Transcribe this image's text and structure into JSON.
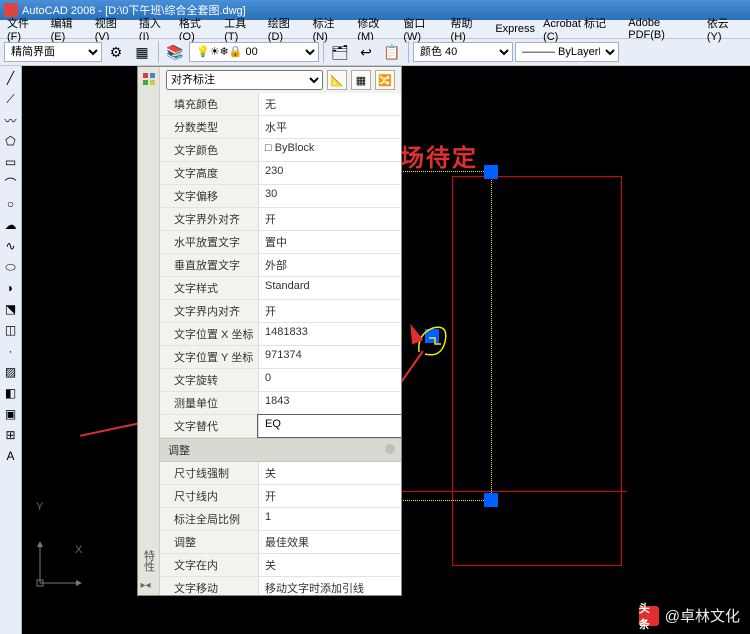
{
  "title": "AutoCAD 2008 - [D:\\0下午班\\综合全套图.dwg]",
  "menus": [
    "文件(F)",
    "编辑(E)",
    "视图(V)",
    "插入(I)",
    "格式(O)",
    "工具(T)",
    "绘图(D)",
    "标注(N)",
    "修改(M)",
    "窗口(W)",
    "帮助(H)",
    "Express",
    "Acrobat 标记(C)",
    "Adobe PDF(B)",
    "依云(Y)"
  ],
  "toolbar": {
    "workspace": "精简界面",
    "layer": "0",
    "color_label": "颜色",
    "color_value": "40",
    "linetype": "ByLayer"
  },
  "annotation": "尺寸现场待定",
  "palette": {
    "title": "特性",
    "selector": "对齐标注",
    "sections": [
      {
        "name": null,
        "rows": [
          {
            "label": "填充颜色",
            "value": "无"
          },
          {
            "label": "分数类型",
            "value": "水平"
          },
          {
            "label": "文字颜色",
            "value": "□ ByBlock"
          },
          {
            "label": "文字高度",
            "value": "230"
          },
          {
            "label": "文字偏移",
            "value": "30"
          },
          {
            "label": "文字界外对齐",
            "value": "开"
          },
          {
            "label": "水平放置文字",
            "value": "置中"
          },
          {
            "label": "垂直放置文字",
            "value": "外部"
          },
          {
            "label": "文字样式",
            "value": "Standard"
          },
          {
            "label": "文字界内对齐",
            "value": "开"
          },
          {
            "label": "文字位置 X 坐标",
            "value": "1481833"
          },
          {
            "label": "文字位置 Y 坐标",
            "value": "971374"
          },
          {
            "label": "文字旋转",
            "value": "0"
          },
          {
            "label": "测量单位",
            "value": "1843"
          },
          {
            "label": "文字替代",
            "value": "EQ",
            "editing": true
          }
        ]
      },
      {
        "name": "调整",
        "rows": [
          {
            "label": "尺寸线强制",
            "value": "关"
          },
          {
            "label": "尺寸线内",
            "value": "开"
          },
          {
            "label": "标注全局比例",
            "value": "1"
          },
          {
            "label": "调整",
            "value": "最佳效果"
          },
          {
            "label": "文字在内",
            "value": "关"
          },
          {
            "label": "文字移动",
            "value": "移动文字时添加引线"
          }
        ]
      }
    ]
  },
  "watermark": {
    "logo": "头条",
    "text": "@卓林文化"
  }
}
